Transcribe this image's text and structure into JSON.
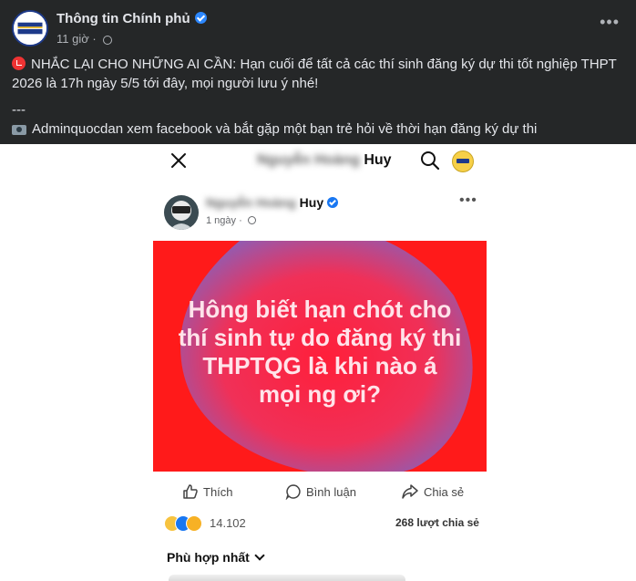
{
  "post": {
    "page_name": "Thông tin Chính phủ",
    "time": "11 giờ",
    "more_label": "•••",
    "caption_line1": "NHẮC LẠI CHO NHỮNG AI CẦN: Hạn cuối để tất cả các thí sinh đăng ký dự thi tốt nghiệp THPT 2026 là 17h ngày 5/5 tới đây, mọi người lưu ý nhé!",
    "caption_sep": "---",
    "caption_line2": "Adminquocdan xem facebook và bắt gặp một bạn trẻ hỏi về thời hạn đăng ký dự thi"
  },
  "screenshot": {
    "topbar_name_blurred": "Nguyễn Hoàng",
    "topbar_name_visible": "Huy",
    "inner_name_blurred": "Nguyễn Hoàng",
    "inner_name_visible": "Huy",
    "inner_time": "1 ngày",
    "inner_more": "•••",
    "image_text_lines": [
      "Hông biết hạn chót cho",
      "thí sinh tự do đăng ký thi",
      "THPTQG là khi nào á",
      "mọi ng ơi?"
    ],
    "actions": {
      "like": "Thích",
      "comment": "Bình luận",
      "share": "Chia sẻ"
    },
    "reaction_count": "14.102",
    "share_count": "268 lượt chia sẻ",
    "sort_label": "Phù hợp nhất"
  },
  "colors": {
    "dark_bg": "#252728",
    "image_red": "#ff1a1a",
    "blob_purple": "#8a5fb8",
    "verified_blue": "#2d88ff"
  }
}
